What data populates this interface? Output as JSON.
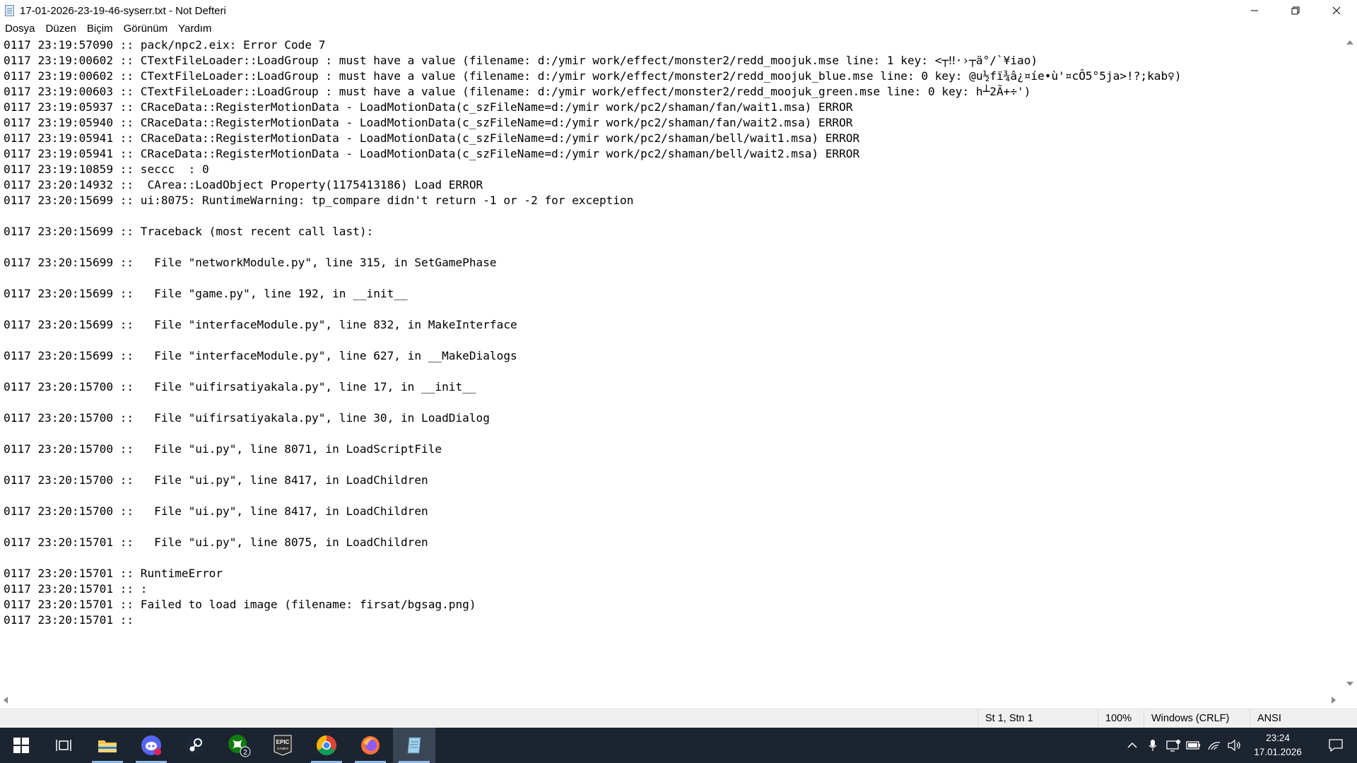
{
  "window": {
    "title": "17-01-2026-23-19-46-syserr.txt - Not Defteri"
  },
  "menu": [
    "Dosya",
    "Düzen",
    "Biçim",
    "Görünüm",
    "Yardım"
  ],
  "lines": [
    "0117 23:19:57090 :: pack/npc2.eix: Error Code 7",
    "0117 23:19:00602 :: CTextFileLoader::LoadGroup : must have a value (filename: d:/ymir work/effect/monster2/redd_moojuk.mse line: 1 key: <┬‼·›┬ä°/`¥iao)",
    "0117 23:19:00602 :: CTextFileLoader::LoadGroup : must have a value (filename: d:/ymir work/effect/monster2/redd_moojuk_blue.mse line: 0 key: @u½fï¾â¿¤íe•ù'¤cÔ5°5ja>!?;kab♀)",
    "0117 23:19:00603 :: CTextFileLoader::LoadGroup : must have a value (filename: d:/ymir work/effect/monster2/redd_moojuk_green.mse line: 0 key: h┴2Ã+÷')",
    "0117 23:19:05937 :: CRaceData::RegisterMotionData - LoadMotionData(c_szFileName=d:/ymir work/pc2/shaman/fan/wait1.msa) ERROR",
    "0117 23:19:05940 :: CRaceData::RegisterMotionData - LoadMotionData(c_szFileName=d:/ymir work/pc2/shaman/fan/wait2.msa) ERROR",
    "0117 23:19:05941 :: CRaceData::RegisterMotionData - LoadMotionData(c_szFileName=d:/ymir work/pc2/shaman/bell/wait1.msa) ERROR",
    "0117 23:19:05941 :: CRaceData::RegisterMotionData - LoadMotionData(c_szFileName=d:/ymir work/pc2/shaman/bell/wait2.msa) ERROR",
    "0117 23:19:10859 :: seccc  : 0",
    "0117 23:20:14932 ::  CArea::LoadObject Property(1175413186) Load ERROR",
    "0117 23:20:15699 :: ui:8075: RuntimeWarning: tp_compare didn't return -1 or -2 for exception",
    "",
    "0117 23:20:15699 :: Traceback (most recent call last):",
    "",
    "0117 23:20:15699 ::   File \"networkModule.py\", line 315, in SetGamePhase",
    "",
    "0117 23:20:15699 ::   File \"game.py\", line 192, in __init__",
    "",
    "0117 23:20:15699 ::   File \"interfaceModule.py\", line 832, in MakeInterface",
    "",
    "0117 23:20:15699 ::   File \"interfaceModule.py\", line 627, in __MakeDialogs",
    "",
    "0117 23:20:15700 ::   File \"uifirsatiyakala.py\", line 17, in __init__",
    "",
    "0117 23:20:15700 ::   File \"uifirsatiyakala.py\", line 30, in LoadDialog",
    "",
    "0117 23:20:15700 ::   File \"ui.py\", line 8071, in LoadScriptFile",
    "",
    "0117 23:20:15700 ::   File \"ui.py\", line 8417, in LoadChildren",
    "",
    "0117 23:20:15700 ::   File \"ui.py\", line 8417, in LoadChildren",
    "",
    "0117 23:20:15701 ::   File \"ui.py\", line 8075, in LoadChildren",
    "",
    "0117 23:20:15701 :: RuntimeError",
    "0117 23:20:15701 :: :",
    "0117 23:20:15701 :: Failed to load image (filename: firsat/bgsag.png)",
    "0117 23:20:15701 :: "
  ],
  "status": {
    "position": "St 1, Stn 1",
    "zoom": "100%",
    "line_ending": "Windows (CRLF)",
    "encoding": "ANSI"
  },
  "taskbar": {
    "time": "23:24",
    "date": "17.01.2026",
    "xbox_badge": "2",
    "epic_label_1": "EPIC",
    "epic_label_2": "GAMES"
  },
  "colors": {
    "taskbar_bg": "#1c2430",
    "statusbar_bg": "#f0f0f0",
    "accent": "#8fb8e6"
  }
}
